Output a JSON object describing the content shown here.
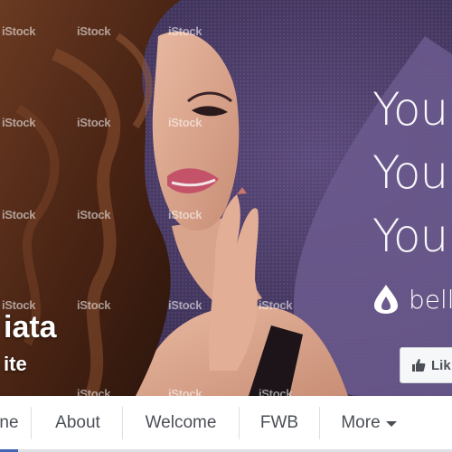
{
  "cover": {
    "tagline_lines": [
      "You",
      "You",
      "You"
    ],
    "brand_name": "belli",
    "like_label": "Lik",
    "page_name": "iata",
    "page_category": "ite",
    "watermark_text": "iStock",
    "colors": {
      "background": "#463862",
      "drop": "#6c5a8e",
      "white": "#ffffff"
    }
  },
  "tabs": [
    {
      "label": "ne",
      "active": true
    },
    {
      "label": "About",
      "active": false
    },
    {
      "label": "Welcome",
      "active": false
    },
    {
      "label": "FWB",
      "active": false
    },
    {
      "label": "More",
      "active": false,
      "has_dropdown": true
    }
  ],
  "accent_color": "#4267b2"
}
